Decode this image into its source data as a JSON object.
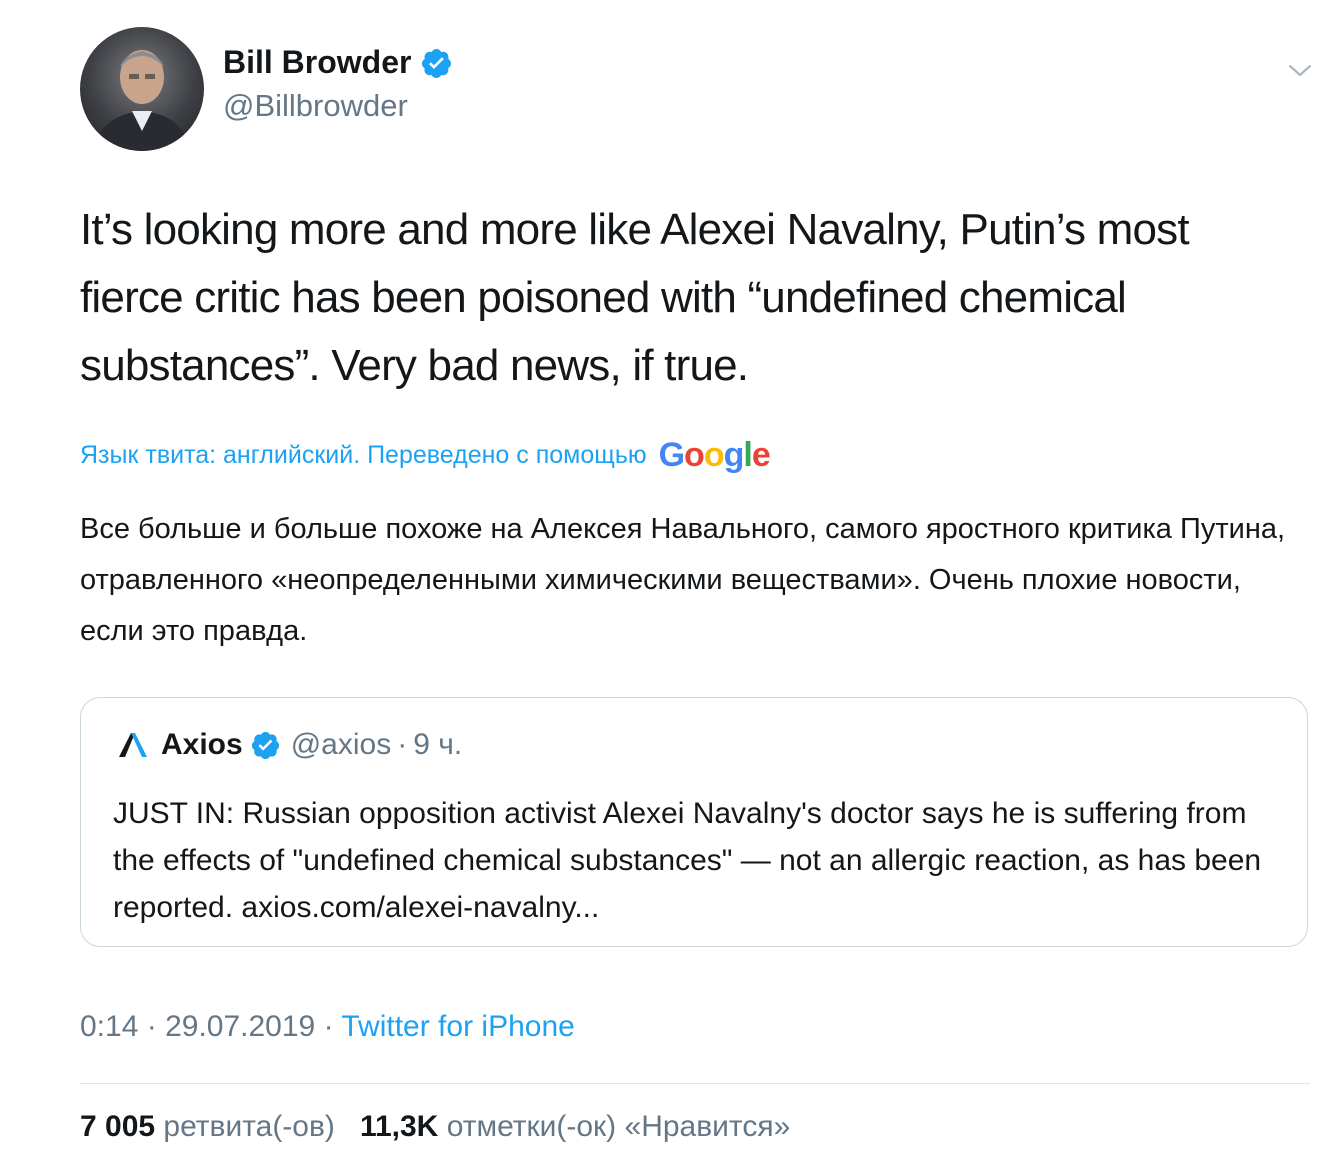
{
  "author": {
    "name": "Bill Browder",
    "handle": "@Billbrowder",
    "verified": true
  },
  "tweet": {
    "text": "It’s looking more and more like Alexei Navalny, Putin’s most fierce critic has been poisoned with “undefined chemical substances”. Very bad news, if true."
  },
  "translation": {
    "label": "Язык твита: английский. Переведено с помощью",
    "provider_letters": [
      "G",
      "o",
      "o",
      "g",
      "l",
      "e"
    ],
    "text": "Все больше и больше похоже на Алексея Навального, самого яростного критика Путина, отравленного «неопределенными химическими веществами». Очень плохие новости, если это правда."
  },
  "quote": {
    "name": "Axios",
    "handle": "@axios",
    "separator": "·",
    "time": "9 ч.",
    "text": "JUST IN: Russian opposition activist Alexei Navalny's doctor says he is suffering from the effects of \"undefined chemical substances\" — not an allergic reaction, as has been reported. axios.com/alexei-navalny..."
  },
  "meta": {
    "time": "0:14",
    "sep1": "·",
    "date": "29.07.2019",
    "sep2": "·",
    "source": "Twitter for iPhone"
  },
  "stats": {
    "retweets_count": "7 005",
    "retweets_label": "ретвита(-ов)",
    "likes_count": "11,3K",
    "likes_label": "отметки(-ок) «Нравится»"
  },
  "colors": {
    "accent": "#1da1f2",
    "secondary_text": "#657786",
    "primary_text": "#14171a",
    "google_blue": "#4285f4",
    "google_red": "#ea4335",
    "google_yellow": "#fbbc05",
    "google_green": "#34a853"
  },
  "icons": [
    "verified-badge-icon",
    "chevron-down-icon",
    "axios-logo-icon",
    "avatar-photo"
  ]
}
